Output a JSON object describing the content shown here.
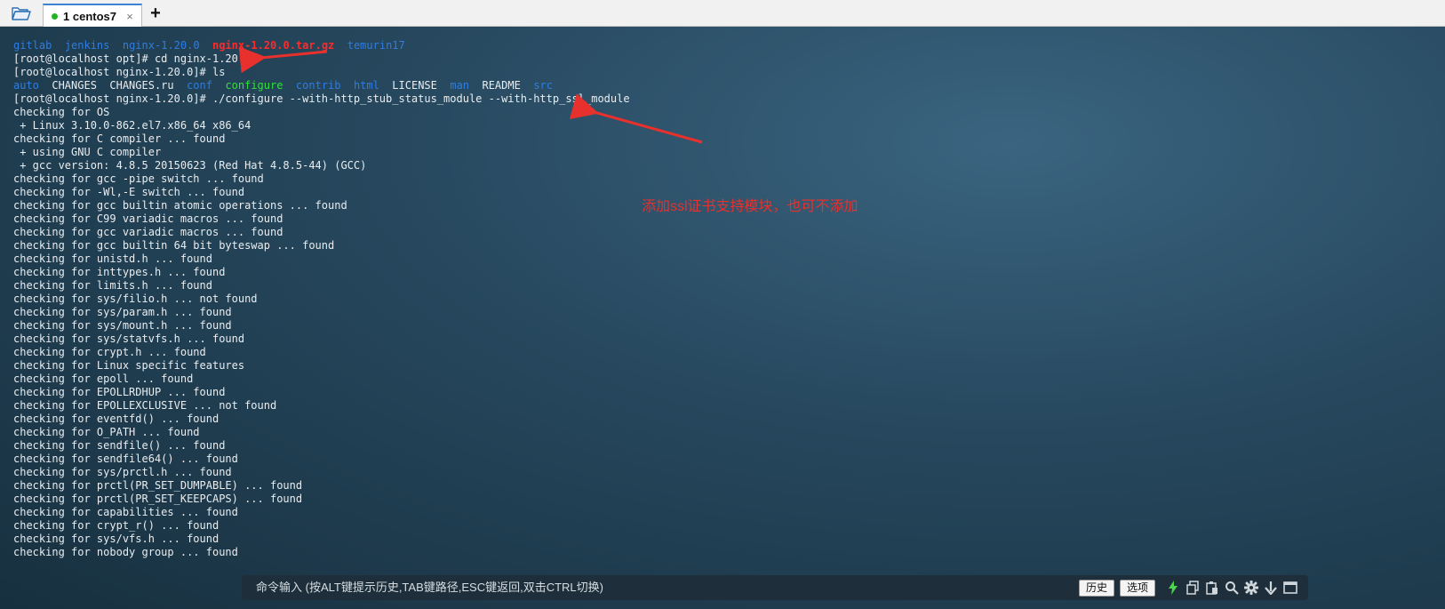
{
  "tabs": [
    {
      "number": "1",
      "name": "centos7",
      "close": "×"
    }
  ],
  "add_tab": "+",
  "terminal": {
    "lines": [
      [
        [
          "gitlab",
          "blue"
        ],
        [
          "  ",
          "white"
        ],
        [
          "jenkins",
          "blue"
        ],
        [
          "  ",
          "white"
        ],
        [
          "nginx-1.20.0",
          "blue"
        ],
        [
          "  ",
          "white"
        ],
        [
          "nginx-1.20.0.tar.gz",
          "red"
        ],
        [
          "  ",
          "white"
        ],
        [
          "temurin17",
          "blue"
        ]
      ],
      [
        [
          "[root@localhost opt]# cd nginx-1.20.0/",
          "white"
        ]
      ],
      [
        [
          "[root@localhost nginx-1.20.0]# ls",
          "white"
        ]
      ],
      [
        [
          "auto",
          "blue"
        ],
        [
          "  CHANGES  CHANGES.ru  ",
          "white"
        ],
        [
          "conf",
          "blue"
        ],
        [
          "  ",
          "white"
        ],
        [
          "configure",
          "green"
        ],
        [
          "  ",
          "white"
        ],
        [
          "contrib",
          "blue"
        ],
        [
          "  ",
          "white"
        ],
        [
          "html",
          "blue"
        ],
        [
          "  LICENSE  ",
          "white"
        ],
        [
          "man",
          "blue"
        ],
        [
          "  README  ",
          "white"
        ],
        [
          "src",
          "blue"
        ]
      ],
      [
        [
          "[root@localhost nginx-1.20.0]# ./configure --with-http_stub_status_module --with-http_ssl_module",
          "white"
        ]
      ],
      [
        [
          "checking for OS",
          "white"
        ]
      ],
      [
        [
          " + Linux 3.10.0-862.el7.x86_64 x86_64",
          "white"
        ]
      ],
      [
        [
          "checking for C compiler ... found",
          "white"
        ]
      ],
      [
        [
          " + using GNU C compiler",
          "white"
        ]
      ],
      [
        [
          " + gcc version: 4.8.5 20150623 (Red Hat 4.8.5-44) (GCC)",
          "white"
        ]
      ],
      [
        [
          "checking for gcc -pipe switch ... found",
          "white"
        ]
      ],
      [
        [
          "checking for -Wl,-E switch ... found",
          "white"
        ]
      ],
      [
        [
          "checking for gcc builtin atomic operations ... found",
          "white"
        ]
      ],
      [
        [
          "checking for C99 variadic macros ... found",
          "white"
        ]
      ],
      [
        [
          "checking for gcc variadic macros ... found",
          "white"
        ]
      ],
      [
        [
          "checking for gcc builtin 64 bit byteswap ... found",
          "white"
        ]
      ],
      [
        [
          "checking for unistd.h ... found",
          "white"
        ]
      ],
      [
        [
          "checking for inttypes.h ... found",
          "white"
        ]
      ],
      [
        [
          "checking for limits.h ... found",
          "white"
        ]
      ],
      [
        [
          "checking for sys/filio.h ... not found",
          "white"
        ]
      ],
      [
        [
          "checking for sys/param.h ... found",
          "white"
        ]
      ],
      [
        [
          "checking for sys/mount.h ... found",
          "white"
        ]
      ],
      [
        [
          "checking for sys/statvfs.h ... found",
          "white"
        ]
      ],
      [
        [
          "checking for crypt.h ... found",
          "white"
        ]
      ],
      [
        [
          "checking for Linux specific features",
          "white"
        ]
      ],
      [
        [
          "checking for epoll ... found",
          "white"
        ]
      ],
      [
        [
          "checking for EPOLLRDHUP ... found",
          "white"
        ]
      ],
      [
        [
          "checking for EPOLLEXCLUSIVE ... not found",
          "white"
        ]
      ],
      [
        [
          "checking for eventfd() ... found",
          "white"
        ]
      ],
      [
        [
          "checking for O_PATH ... found",
          "white"
        ]
      ],
      [
        [
          "checking for sendfile() ... found",
          "white"
        ]
      ],
      [
        [
          "checking for sendfile64() ... found",
          "white"
        ]
      ],
      [
        [
          "checking for sys/prctl.h ... found",
          "white"
        ]
      ],
      [
        [
          "checking for prctl(PR_SET_DUMPABLE) ... found",
          "white"
        ]
      ],
      [
        [
          "checking for prctl(PR_SET_KEEPCAPS) ... found",
          "white"
        ]
      ],
      [
        [
          "checking for capabilities ... found",
          "white"
        ]
      ],
      [
        [
          "checking for crypt_r() ... found",
          "white"
        ]
      ],
      [
        [
          "checking for sys/vfs.h ... found",
          "white"
        ]
      ],
      [
        [
          "checking for nobody group ... found",
          "white"
        ]
      ]
    ]
  },
  "annotation": "添加ssl证书支持模块，也可不添加",
  "command_bar": {
    "placeholder": "命令输入 (按ALT键提示历史,TAB键路径,ESC键返回,双击CTRL切换)",
    "history_label": "历史",
    "options_label": "选项",
    "icons": [
      "lightning-icon",
      "copy-icon",
      "paste-icon",
      "search-icon",
      "gear-icon",
      "arrow-down-icon",
      "window-icon"
    ]
  },
  "colors": {
    "blue": "#2f7de0",
    "red": "#ff2a2a",
    "green": "#33e03a",
    "white": "#e9edf0",
    "annotation": "#e8302c",
    "tab_dot": "#21b421"
  }
}
